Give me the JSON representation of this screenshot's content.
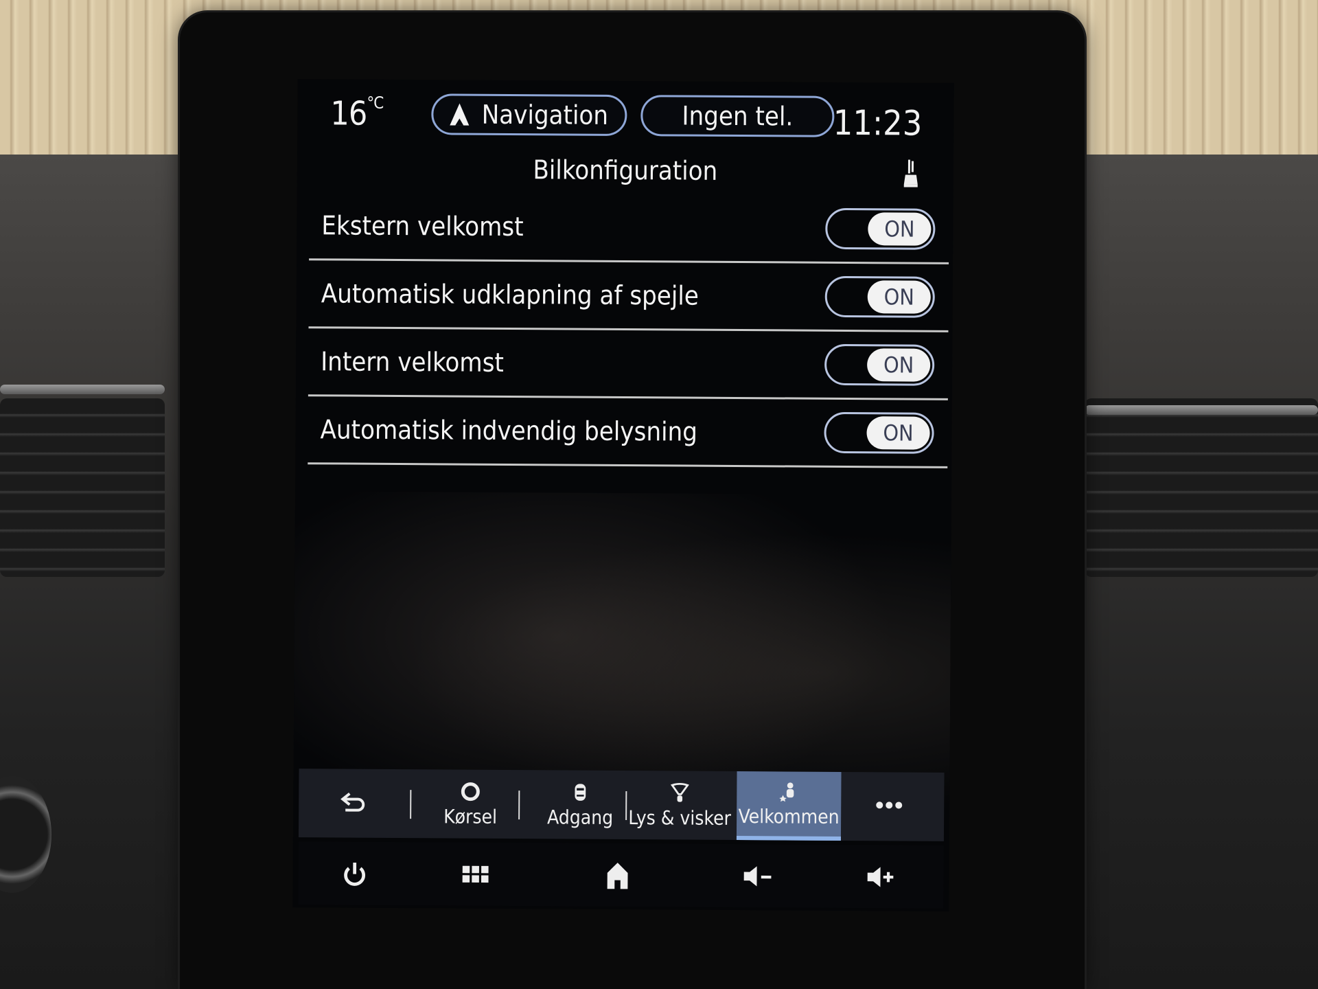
{
  "status_bar": {
    "temperature": "16",
    "temperature_unit": "°C",
    "navigation_label": "Navigation",
    "phone_label": "Ingen tel.",
    "clock": "11:23"
  },
  "page": {
    "title": "Bilkonfiguration",
    "header_icon": "seat-icon"
  },
  "settings": [
    {
      "label": "Ekstern velkomst",
      "state": "ON",
      "enabled": true
    },
    {
      "label": "Automatisk udklapning af spejle",
      "state": "ON",
      "enabled": true
    },
    {
      "label": "Intern velkomst",
      "state": "ON",
      "enabled": true
    },
    {
      "label": "Automatisk indvendig belysning",
      "state": "ON",
      "enabled": true
    }
  ],
  "tabs": [
    {
      "label": "",
      "icon": "back-arrow-icon"
    },
    {
      "label": "Kørsel",
      "icon": "steering-icon"
    },
    {
      "label": "Adgang",
      "icon": "car-top-icon"
    },
    {
      "label": "Lys & visker",
      "icon": "wiper-light-icon"
    },
    {
      "label": "Velkommen",
      "icon": "welcome-person-icon",
      "active": true
    },
    {
      "label": "",
      "icon": "more-icon"
    }
  ],
  "system_bar": [
    {
      "icon": "power-icon"
    },
    {
      "icon": "apps-grid-icon"
    },
    {
      "icon": "home-icon"
    },
    {
      "icon": "volume-down-icon"
    },
    {
      "icon": "volume-up-icon"
    }
  ],
  "colors": {
    "accent": "#8ea6d6",
    "active_tab": "#5a6f95",
    "toggle_knob": "#f2f2f2"
  }
}
